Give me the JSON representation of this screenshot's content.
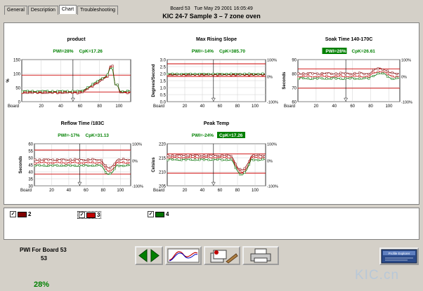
{
  "tabs": [
    "General",
    "Description",
    "Chart",
    "Troubleshooting"
  ],
  "active_tab": "Chart",
  "header": {
    "board": "Board 53",
    "date": "Tue May 29 2001 16:05:49"
  },
  "title": "KIC 24-7 Sample 3 – 7 zone oven",
  "charts": [
    {
      "title": "product",
      "pwi": "PWI=28%",
      "cpk": "CpK=17.26",
      "highlight": "",
      "ylabel": "%",
      "xlabel": "Board",
      "yticks": [
        "150",
        "100",
        "50",
        "0"
      ],
      "xticks": [
        "20",
        "40",
        "60",
        "80",
        "100"
      ],
      "rticks": []
    },
    {
      "title": "Max Rising Slope",
      "pwi": "PWI=-14%",
      "cpk": "CpK=385.70",
      "highlight": "",
      "ylabel": "Degrees/Second",
      "xlabel": "Board",
      "yticks": [
        "3.0",
        "2.5",
        "2.0",
        "1.5",
        "1.0",
        "0.5",
        "0.0"
      ],
      "xticks": [
        "20",
        "40",
        "60",
        "80",
        "100"
      ],
      "rticks": [
        "100%",
        "0%",
        "-100%"
      ]
    },
    {
      "title": "Soak Time 140-170C",
      "pwi": "PWI=28%",
      "cpk": "CpK=26.61",
      "highlight": "pwi",
      "ylabel": "Seconds",
      "xlabel": "Board",
      "yticks": [
        "90",
        "80",
        "70",
        "60"
      ],
      "xticks": [
        "20",
        "40",
        "60",
        "80",
        "100"
      ],
      "rticks": [
        "100%",
        "0%",
        "-100%"
      ]
    },
    {
      "title": "Reflow Time /183C",
      "pwi": "PWI=-17%",
      "cpk": "CpK=31.13",
      "highlight": "",
      "ylabel": "Seconds",
      "xlabel": "Board",
      "yticks": [
        "60",
        "55",
        "50",
        "45",
        "40",
        "35",
        "30"
      ],
      "xticks": [
        "20",
        "40",
        "60",
        "80",
        "100"
      ],
      "rticks": [
        "100%",
        "0%",
        "-100%"
      ]
    },
    {
      "title": "Peak Temp",
      "pwi": "PWI=-24%",
      "cpk": "CpK=17.26",
      "highlight": "cpk",
      "ylabel": "Celsius",
      "xlabel": "Board",
      "yticks": [
        "220",
        "215",
        "210",
        "205"
      ],
      "xticks": [
        "20",
        "40",
        "60",
        "80",
        "100"
      ],
      "rticks": [
        "100%",
        "0%",
        "-100%"
      ]
    }
  ],
  "legend": [
    {
      "label": "2",
      "color": "#800000",
      "checked": "✓"
    },
    {
      "label": "3",
      "color": "#c00000",
      "checked": "✓"
    },
    {
      "label": "4",
      "color": "#007000",
      "checked": "✓"
    }
  ],
  "pwi": {
    "label": "PWI For Board  53",
    "board": "53",
    "value": "28%"
  },
  "logo_text": "Profile Explorer",
  "watermark": "KIC.cn",
  "colors": {
    "green": "#008000",
    "red": "#cc0000",
    "grid": "#c0c0c0"
  }
}
